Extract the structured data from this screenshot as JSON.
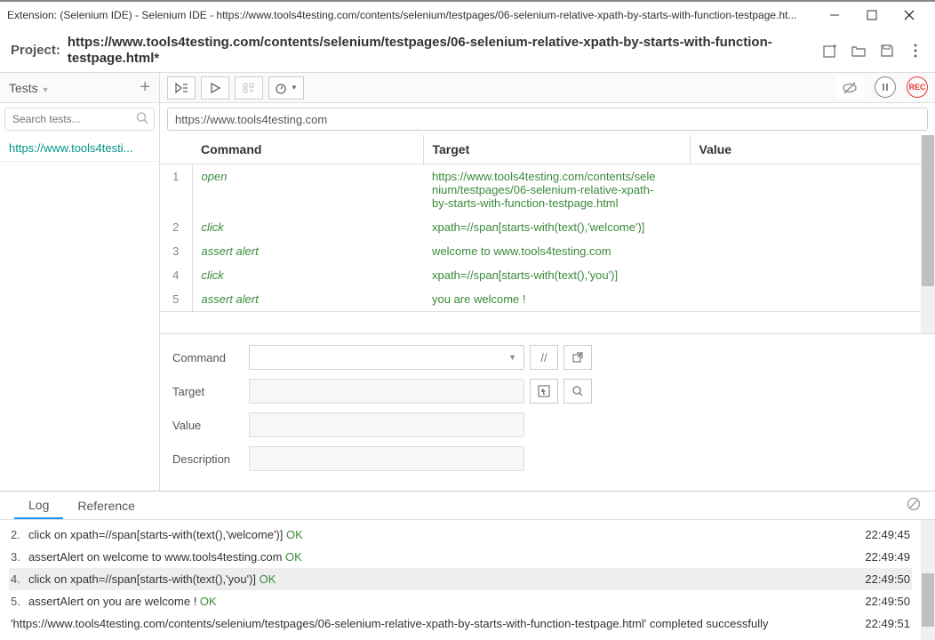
{
  "titlebar": "Extension: (Selenium IDE) - Selenium IDE - https://www.tools4testing.com/contents/selenium/testpages/06-selenium-relative-xpath-by-starts-with-function-testpage.ht...",
  "project": {
    "label": "Project:",
    "title": "https://www.tools4testing.com/contents/selenium/testpages/06-selenium-relative-xpath-by-starts-with-function-testpage.html*"
  },
  "sidebar": {
    "title": "Tests",
    "search_placeholder": "Search tests...",
    "items": [
      "https://www.tools4testi..."
    ]
  },
  "base_url": "https://www.tools4testing.com",
  "table": {
    "headers": {
      "command": "Command",
      "target": "Target",
      "value": "Value"
    },
    "rows": [
      {
        "n": "1",
        "command": "open",
        "target": "https://www.tools4testing.com/contents/selenium/testpages/06-selenium-relative-xpath-by-starts-with-function-testpage.html",
        "value": ""
      },
      {
        "n": "2",
        "command": "click",
        "target": "xpath=//span[starts-with(text(),'welcome')]",
        "value": ""
      },
      {
        "n": "3",
        "command": "assert alert",
        "target": "welcome to www.tools4testing.com",
        "value": ""
      },
      {
        "n": "4",
        "command": "click",
        "target": "xpath=//span[starts-with(text(),'you')]",
        "value": ""
      },
      {
        "n": "5",
        "command": "assert alert",
        "target": "you are welcome !",
        "value": ""
      }
    ]
  },
  "form": {
    "command": "Command",
    "target": "Target",
    "value": "Value",
    "description": "Description"
  },
  "log": {
    "tabs": {
      "log": "Log",
      "reference": "Reference"
    },
    "entries": [
      {
        "n": "2.",
        "text": "click on xpath=//span[starts-with(text(),'welcome')]",
        "status": "OK",
        "time": "22:49:45",
        "hl": false
      },
      {
        "n": "3.",
        "text": "assertAlert on welcome to www.tools4testing.com",
        "status": "OK",
        "time": "22:49:49",
        "hl": false
      },
      {
        "n": "4.",
        "text": "click on xpath=//span[starts-with(text(),'you')]",
        "status": "OK",
        "time": "22:49:50",
        "hl": true
      },
      {
        "n": "5.",
        "text": "assertAlert on you are welcome !",
        "status": "OK",
        "time": "22:49:50",
        "hl": false
      }
    ],
    "final": {
      "prefix": "'https://www.tools4testing.com/contents/selenium/testpages/06-selenium-relative-xpath-by-starts-with-function-testpage.html'",
      "suffix": " completed successfully",
      "time": "22:49:51"
    }
  }
}
